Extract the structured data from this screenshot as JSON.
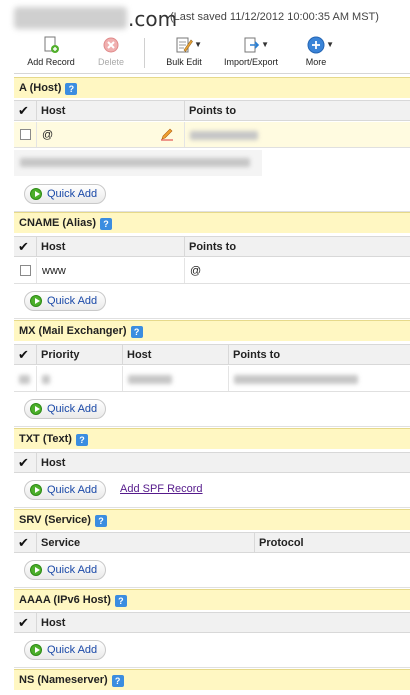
{
  "header": {
    "domain_tld": ".com",
    "last_saved": "(Last saved 11/12/2012 10:00:35 AM MST)"
  },
  "toolbar": {
    "add_record": "Add Record",
    "delete": "Delete",
    "bulk_edit": "Bulk Edit",
    "import_export": "Import/Export",
    "more": "More"
  },
  "quick_add_label": "Quick Add",
  "sections": {
    "a": {
      "title": "A (Host)",
      "columns": [
        "Host",
        "Points to"
      ],
      "rows": [
        {
          "host": "@"
        }
      ]
    },
    "cname": {
      "title": "CNAME (Alias)",
      "columns": [
        "Host",
        "Points to"
      ],
      "rows": [
        {
          "host": "www",
          "points_to": "@"
        }
      ]
    },
    "mx": {
      "title": "MX (Mail Exchanger)",
      "columns": [
        "Priority",
        "Host",
        "Points to"
      ]
    },
    "txt": {
      "title": "TXT (Text)",
      "columns": [
        "Host"
      ],
      "add_spf": "Add SPF Record"
    },
    "srv": {
      "title": "SRV (Service)",
      "columns": [
        "Service",
        "Protocol"
      ]
    },
    "aaaa": {
      "title": "AAAA (IPv6 Host)",
      "columns": [
        "Host"
      ]
    },
    "ns": {
      "title": "NS (Nameserver)"
    }
  },
  "colors": {
    "section_bg": "#fff7c2",
    "header_bg": "#f1f1f1",
    "link": "#1a49a8",
    "help_icon": "#3b8de0"
  }
}
